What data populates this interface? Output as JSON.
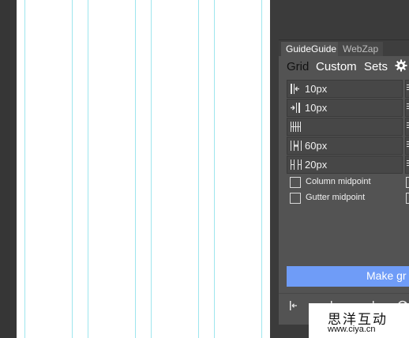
{
  "panel": {
    "tabs": [
      {
        "label": "GuideGuide",
        "active": true
      },
      {
        "label": "WebZap",
        "active": false
      }
    ],
    "nav": {
      "grid": "Grid",
      "custom": "Custom",
      "sets": "Sets",
      "settings_icon": "gear-icon"
    },
    "fields": [
      {
        "icon": "left-margin-icon",
        "value": "10px"
      },
      {
        "icon": "right-margin-icon",
        "value": "10px"
      },
      {
        "icon": "columns-icon",
        "value": ""
      },
      {
        "icon": "column-width-icon",
        "value": "60px"
      },
      {
        "icon": "gutter-width-icon",
        "value": "20px"
      }
    ],
    "checkboxes": [
      {
        "label": "Column midpoint",
        "checked": false
      },
      {
        "label": "Gutter midpoint",
        "checked": false
      }
    ],
    "make_button": "Make gr",
    "colors": {
      "accent": "#6f9cf7",
      "guide": "#9ee6ee",
      "panel": "#535353"
    }
  },
  "watermark": {
    "chinese": "思洋互动",
    "url": "www.ciya.cn"
  }
}
